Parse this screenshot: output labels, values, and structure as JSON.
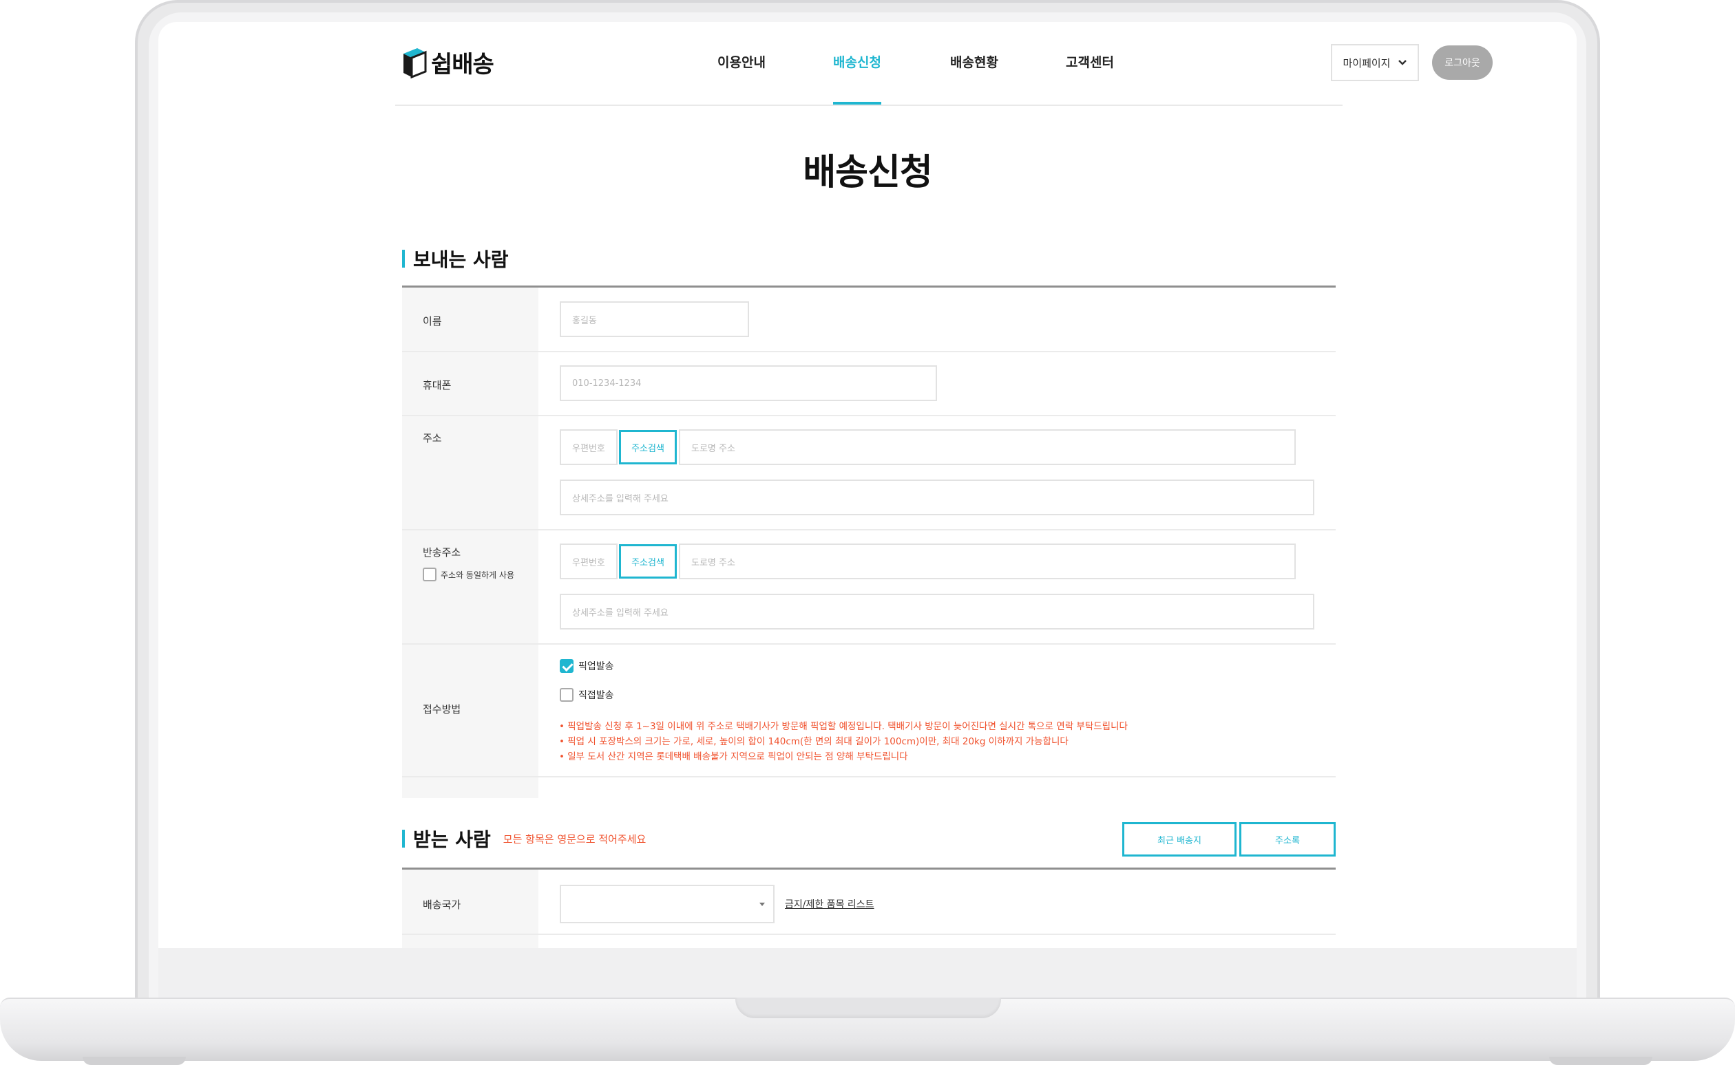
{
  "header": {
    "logo_text": "쉽배송",
    "nav": [
      "이용안내",
      "배송신청",
      "배송현황",
      "고객센터"
    ],
    "active_nav": "배송신청",
    "mypage_label": "마이페이지",
    "logout_label": "로그아웃"
  },
  "page_title": "배송신청",
  "sender": {
    "section_title": "보내는 사람",
    "name_label": "이름",
    "name_placeholder": "홍길동",
    "phone_label": "휴대폰",
    "phone_placeholder": "010-1234-1234",
    "address_label": "주소",
    "zip_placeholder": "우편번호",
    "search_label": "주소검색",
    "road_placeholder": "도로명 주소",
    "detail_placeholder": "상세주소를 입력해 주세요",
    "return_label": "반송주소",
    "same_address_label": "주소와 동일하게 사용",
    "return_zip_placeholder": "우편번호",
    "return_search_label": "주소검색",
    "return_road_placeholder": "도로명 주소",
    "return_detail_placeholder": "상세주소를 입력해 주세요",
    "method_label": "접수방법",
    "pickup_label": "픽업발송",
    "pickup_checked": true,
    "direct_label": "직접발송",
    "direct_checked": false,
    "notices": [
      "• 픽업발송 신청 후 1~3일 이내에 위 주소로 택배기사가 방문해 픽업할 예정입니다. 택배기사 방문이 늦어진다면 실시간 톡으로 연락 부탁드립니다",
      "• 픽업 시 포장박스의 크기는 가로, 세로, 높이의 합이 140cm(한 면의 최대 길이가 100cm)이만, 최대 20kg 이하까지 가능합니다",
      "• 일부 도서 산간 지역은 롯데택배 배송불가 지역으로 픽업이 안되는 점 양해 부탁드립니다"
    ]
  },
  "receiver": {
    "section_title": "받는 사람",
    "note": "모든 항목은 영문으로 적어주세요",
    "recent_button": "최근 배송지",
    "address_book_button": "주소록",
    "country_label": "배송국가",
    "country_value": "",
    "restricted_link": "금지/제한 품목 리스트"
  },
  "colors": {
    "accent": "#1fb6d0",
    "warning": "#f0522e",
    "logout_bg": "#a9a9a9"
  }
}
